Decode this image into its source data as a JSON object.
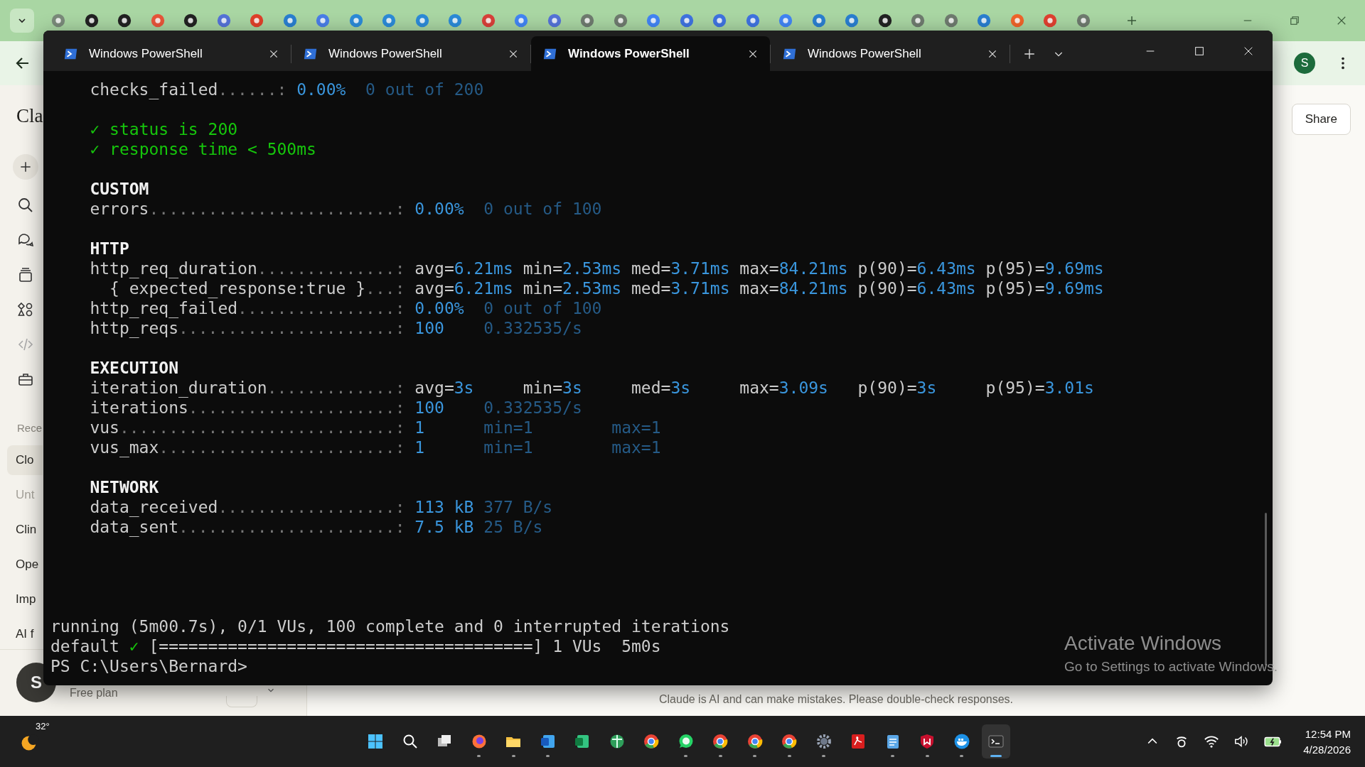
{
  "browser": {
    "profile_initial": "S"
  },
  "claude": {
    "title": "Cla",
    "recents_label": "Rece",
    "recents": [
      {
        "label": "Clo",
        "selected": true,
        "muted": false
      },
      {
        "label": "Unt",
        "selected": false,
        "muted": true
      },
      {
        "label": "Clin",
        "selected": false,
        "muted": false
      },
      {
        "label": "Ope",
        "selected": false,
        "muted": false
      },
      {
        "label": "Imp",
        "selected": false,
        "muted": false
      },
      {
        "label": "AI f",
        "selected": false,
        "muted": false
      }
    ],
    "user": {
      "initial": "S",
      "plan": "Free plan"
    },
    "share": "Share",
    "disclaimer": "Claude is AI and can make mistakes. Please double-check responses."
  },
  "terminal": {
    "tabs": [
      {
        "title": "Windows PowerShell",
        "selected": false
      },
      {
        "title": "Windows PowerShell",
        "selected": false
      },
      {
        "title": "Windows PowerShell",
        "selected": true
      },
      {
        "title": "Windows PowerShell",
        "selected": false
      }
    ],
    "lines": [
      {
        "kind": "metric",
        "name": "checks_failed",
        "leader": "......:",
        "values": [
          {
            "text": "0.00%",
            "dim": false
          },
          {
            "text": "0 out of 200",
            "dim": true
          }
        ]
      },
      {
        "kind": "blank"
      },
      {
        "kind": "check",
        "mark": "✓",
        "text": "status is 200"
      },
      {
        "kind": "check",
        "mark": "✓",
        "text": "response time < 500ms"
      },
      {
        "kind": "blank"
      },
      {
        "kind": "heading",
        "text": "CUSTOM"
      },
      {
        "kind": "metric",
        "name": "errors",
        "leader": ".........................:",
        "values": [
          {
            "text": "0.00%",
            "dim": false
          },
          {
            "text": "0 out of 100",
            "dim": true
          }
        ]
      },
      {
        "kind": "blank"
      },
      {
        "kind": "heading",
        "text": "HTTP"
      },
      {
        "kind": "trend",
        "name": "http_req_duration",
        "leader": "..............:",
        "values": [
          {
            "label": "avg=",
            "text": "6.21ms",
            "dim": false
          },
          {
            "label": "min=",
            "text": "2.53ms",
            "dim": false
          },
          {
            "label": "med=",
            "text": "3.71ms",
            "dim": false
          },
          {
            "label": "max=",
            "text": "84.21ms",
            "dim": false
          },
          {
            "label": "p(90)=",
            "text": "6.43ms",
            "dim": false
          },
          {
            "label": "p(95)=",
            "text": "9.69ms",
            "dim": false
          }
        ]
      },
      {
        "kind": "subtrend",
        "name": "{ expected_response:true }",
        "leader": "...:",
        "values": [
          {
            "label": "avg=",
            "text": "6.21ms",
            "dim": false
          },
          {
            "label": "min=",
            "text": "2.53ms",
            "dim": false
          },
          {
            "label": "med=",
            "text": "3.71ms",
            "dim": false
          },
          {
            "label": "max=",
            "text": "84.21ms",
            "dim": false
          },
          {
            "label": "p(90)=",
            "text": "6.43ms",
            "dim": false
          },
          {
            "label": "p(95)=",
            "text": "9.69ms",
            "dim": false
          }
        ]
      },
      {
        "kind": "metric",
        "name": "http_req_failed",
        "leader": "................:",
        "values": [
          {
            "text": "0.00%",
            "dim": false
          },
          {
            "text": "0 out of 100",
            "dim": true
          }
        ]
      },
      {
        "kind": "metric",
        "name": "http_reqs",
        "leader": "......................:",
        "values": [
          {
            "text": "100",
            "dim": false
          },
          {
            "text": "0.332535/s",
            "dim": true
          }
        ]
      },
      {
        "kind": "blank"
      },
      {
        "kind": "heading",
        "text": "EXECUTION"
      },
      {
        "kind": "trend",
        "name": "iteration_duration",
        "leader": ".............:",
        "values": [
          {
            "label": "avg=",
            "text": "3s",
            "dim": false
          },
          {
            "label": "min=",
            "text": "3s",
            "dim": false
          },
          {
            "label": "med=",
            "text": "3s",
            "dim": false
          },
          {
            "label": "max=",
            "text": "3.09s",
            "dim": false
          },
          {
            "label": "p(90)=",
            "text": "3s",
            "dim": false
          },
          {
            "label": "p(95)=",
            "text": "3.01s",
            "dim": false
          }
        ]
      },
      {
        "kind": "metric",
        "name": "iterations",
        "leader": ".....................:",
        "values": [
          {
            "text": "100",
            "dim": false
          },
          {
            "text": "0.332535/s",
            "dim": true
          }
        ]
      },
      {
        "kind": "metric",
        "name": "vus",
        "leader": "............................:",
        "values": [
          {
            "text": "1",
            "dim": false
          },
          {
            "text": "min=1",
            "dim": true
          },
          {
            "text": "max=1",
            "dim": true
          }
        ]
      },
      {
        "kind": "metric",
        "name": "vus_max",
        "leader": "........................:",
        "values": [
          {
            "text": "1",
            "dim": false
          },
          {
            "text": "min=1",
            "dim": true
          },
          {
            "text": "max=1",
            "dim": true
          }
        ]
      },
      {
        "kind": "blank"
      },
      {
        "kind": "heading",
        "text": "NETWORK"
      },
      {
        "kind": "metric",
        "name": "data_received",
        "leader": "..................:",
        "values": [
          {
            "text": "113 kB",
            "dim": false
          },
          {
            "text": "377 B/s",
            "dim": true
          }
        ]
      },
      {
        "kind": "metric",
        "name": "data_sent",
        "leader": "......................:",
        "values": [
          {
            "text": "7.5 kB",
            "dim": false
          },
          {
            "text": "25 B/s",
            "dim": true
          }
        ]
      },
      {
        "kind": "blank"
      },
      {
        "kind": "blank"
      },
      {
        "kind": "blank"
      },
      {
        "kind": "blank"
      },
      {
        "kind": "status",
        "text": "running (5m00.7s), 0/1 VUs, 100 complete and 0 interrupted iterations"
      },
      {
        "kind": "progress",
        "name": "default",
        "mark": "✓",
        "bar": "[======================================]",
        "values": [
          {
            "text": "1 VUs"
          },
          {
            "text": "5m0s"
          }
        ]
      },
      {
        "kind": "prompt",
        "text": "PS C:\\Users\\Bernard>"
      }
    ]
  },
  "activation": {
    "title": "Activate Windows",
    "body": "Go to Settings to activate Windows."
  },
  "taskbar": {
    "temperature": "32°",
    "time": "12:54 PM",
    "date": "4/28/2026"
  }
}
